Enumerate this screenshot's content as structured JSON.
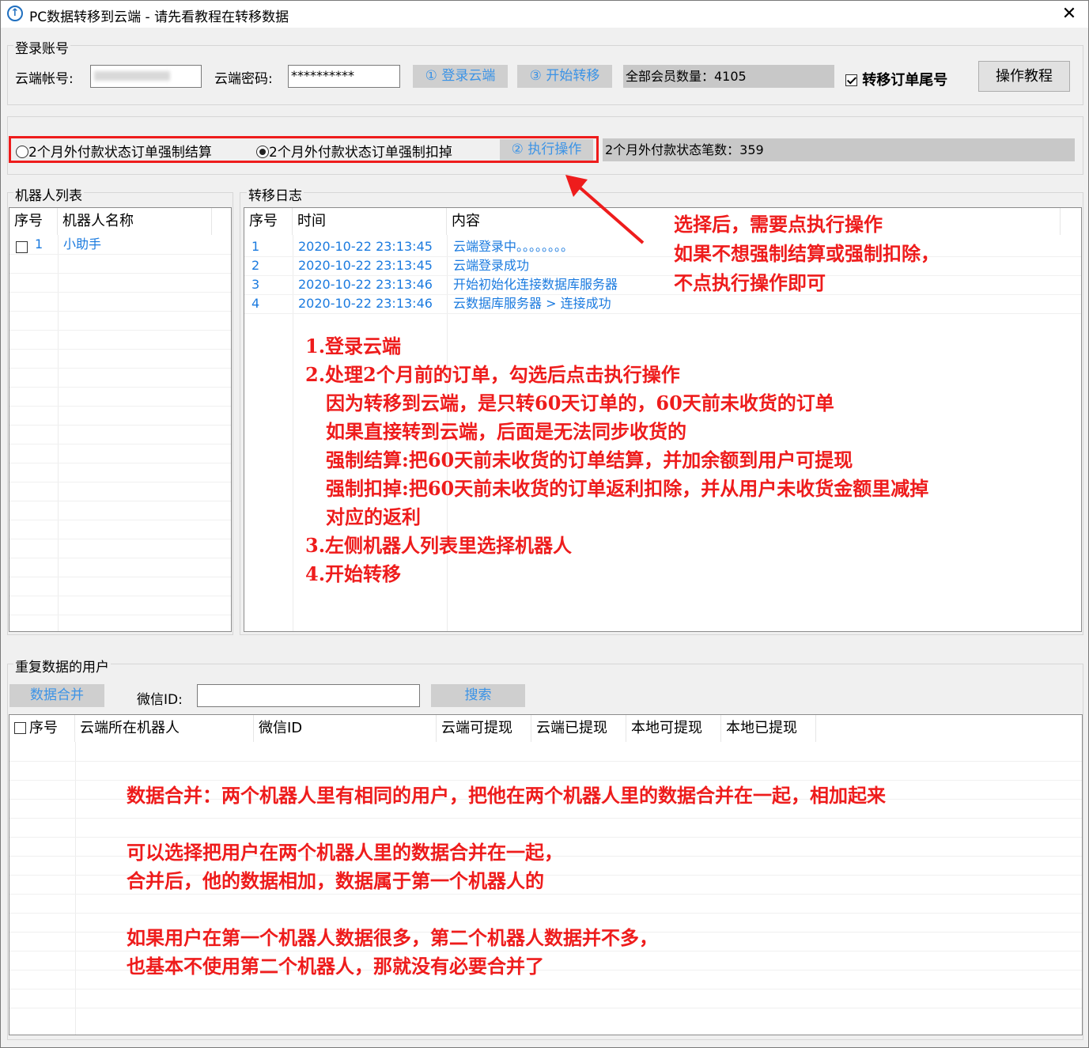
{
  "window": {
    "title": "PC数据转移到云端 - 请先看教程在转移数据",
    "close_glyph": "✕"
  },
  "login": {
    "group_label": "登录账号",
    "account_label": "云端帐号:",
    "account_value": "",
    "password_label": "云端密码:",
    "password_value": "**********",
    "login_button": "① 登录云端",
    "start_button": "③ 开始转移",
    "member_count": "全部会员数量：4105",
    "transfer_suffix_label": "转移订单尾号",
    "transfer_suffix_checked": true,
    "tutorial_button": "操作教程"
  },
  "options": {
    "radio_settle_label": "2个月外付款状态订单强制结算",
    "radio_settle_checked": false,
    "radio_deduct_label": "2个月外付款状态订单强制扣掉",
    "radio_deduct_checked": true,
    "execute_button": "② 执行操作",
    "outstanding_count": "2个月外付款状态笔数：359"
  },
  "robots": {
    "group_label": "机器人列表",
    "headers": [
      "序号",
      "机器人名称"
    ],
    "rows": [
      {
        "index": "1",
        "name": "小助手",
        "checked": false
      }
    ]
  },
  "log": {
    "group_label": "转移日志",
    "headers": [
      "序号",
      "时间",
      "内容"
    ],
    "rows": [
      {
        "index": "1",
        "time": "2020-10-22 23:13:45",
        "content": "云端登录中。。。。。。。。"
      },
      {
        "index": "2",
        "time": "2020-10-22 23:13:45",
        "content": "云端登录成功"
      },
      {
        "index": "3",
        "time": "2020-10-22 23:13:46",
        "content": "开始初始化连接数据库服务器"
      },
      {
        "index": "4",
        "time": "2020-10-22 23:13:46",
        "content": "云数据库服务器 > 连接成功"
      }
    ]
  },
  "duplicates": {
    "group_label": "重复数据的用户",
    "merge_button": "数据合并",
    "wechat_label": "微信ID:",
    "wechat_value": "",
    "search_button": "搜索",
    "headers": [
      "序号",
      "云端所在机器人",
      "微信ID",
      "云端可提现",
      "云端已提现",
      "本地可提现",
      "本地已提现"
    ]
  },
  "annotations": {
    "arrow_note": [
      "选择后，需要点执行操作",
      "如果不想强制结算或强制扣除，",
      "不点执行操作即可"
    ],
    "steps": [
      "1.登录云端",
      "2.处理2个月前的订单，勾选后点击执行操作",
      "因为转移到云端，是只转60天订单的，60天前未收货的订单",
      "如果直接转到云端，后面是无法同步收货的",
      "强制结算:把60天前未收货的订单结算，并加余额到用户可提现",
      "强制扣掉:把60天前未收货的订单返利扣除，并从用户未收货金额里减掉",
      "对应的返利",
      "3.左侧机器人列表里选择机器人",
      "4.开始转移"
    ],
    "merge_notes": [
      "数据合并：两个机器人里有相同的用户，把他在两个机器人里的数据合并在一起，相加起来",
      "可以选择把用户在两个机器人里的数据合并在一起，",
      "合并后，他的数据相加，数据属于第一个机器人的",
      "如果用户在第一个机器人数据很多，第二个机器人数据并不多，",
      "也基本不使用第二个机器人，那就没有必要合并了"
    ],
    "highlight_color": "#ee1c1c"
  },
  "colors": {
    "accent": "#3b93e6",
    "annotation_red": "#ee1c1c",
    "flat_button_bg": "#cfcfcf"
  }
}
